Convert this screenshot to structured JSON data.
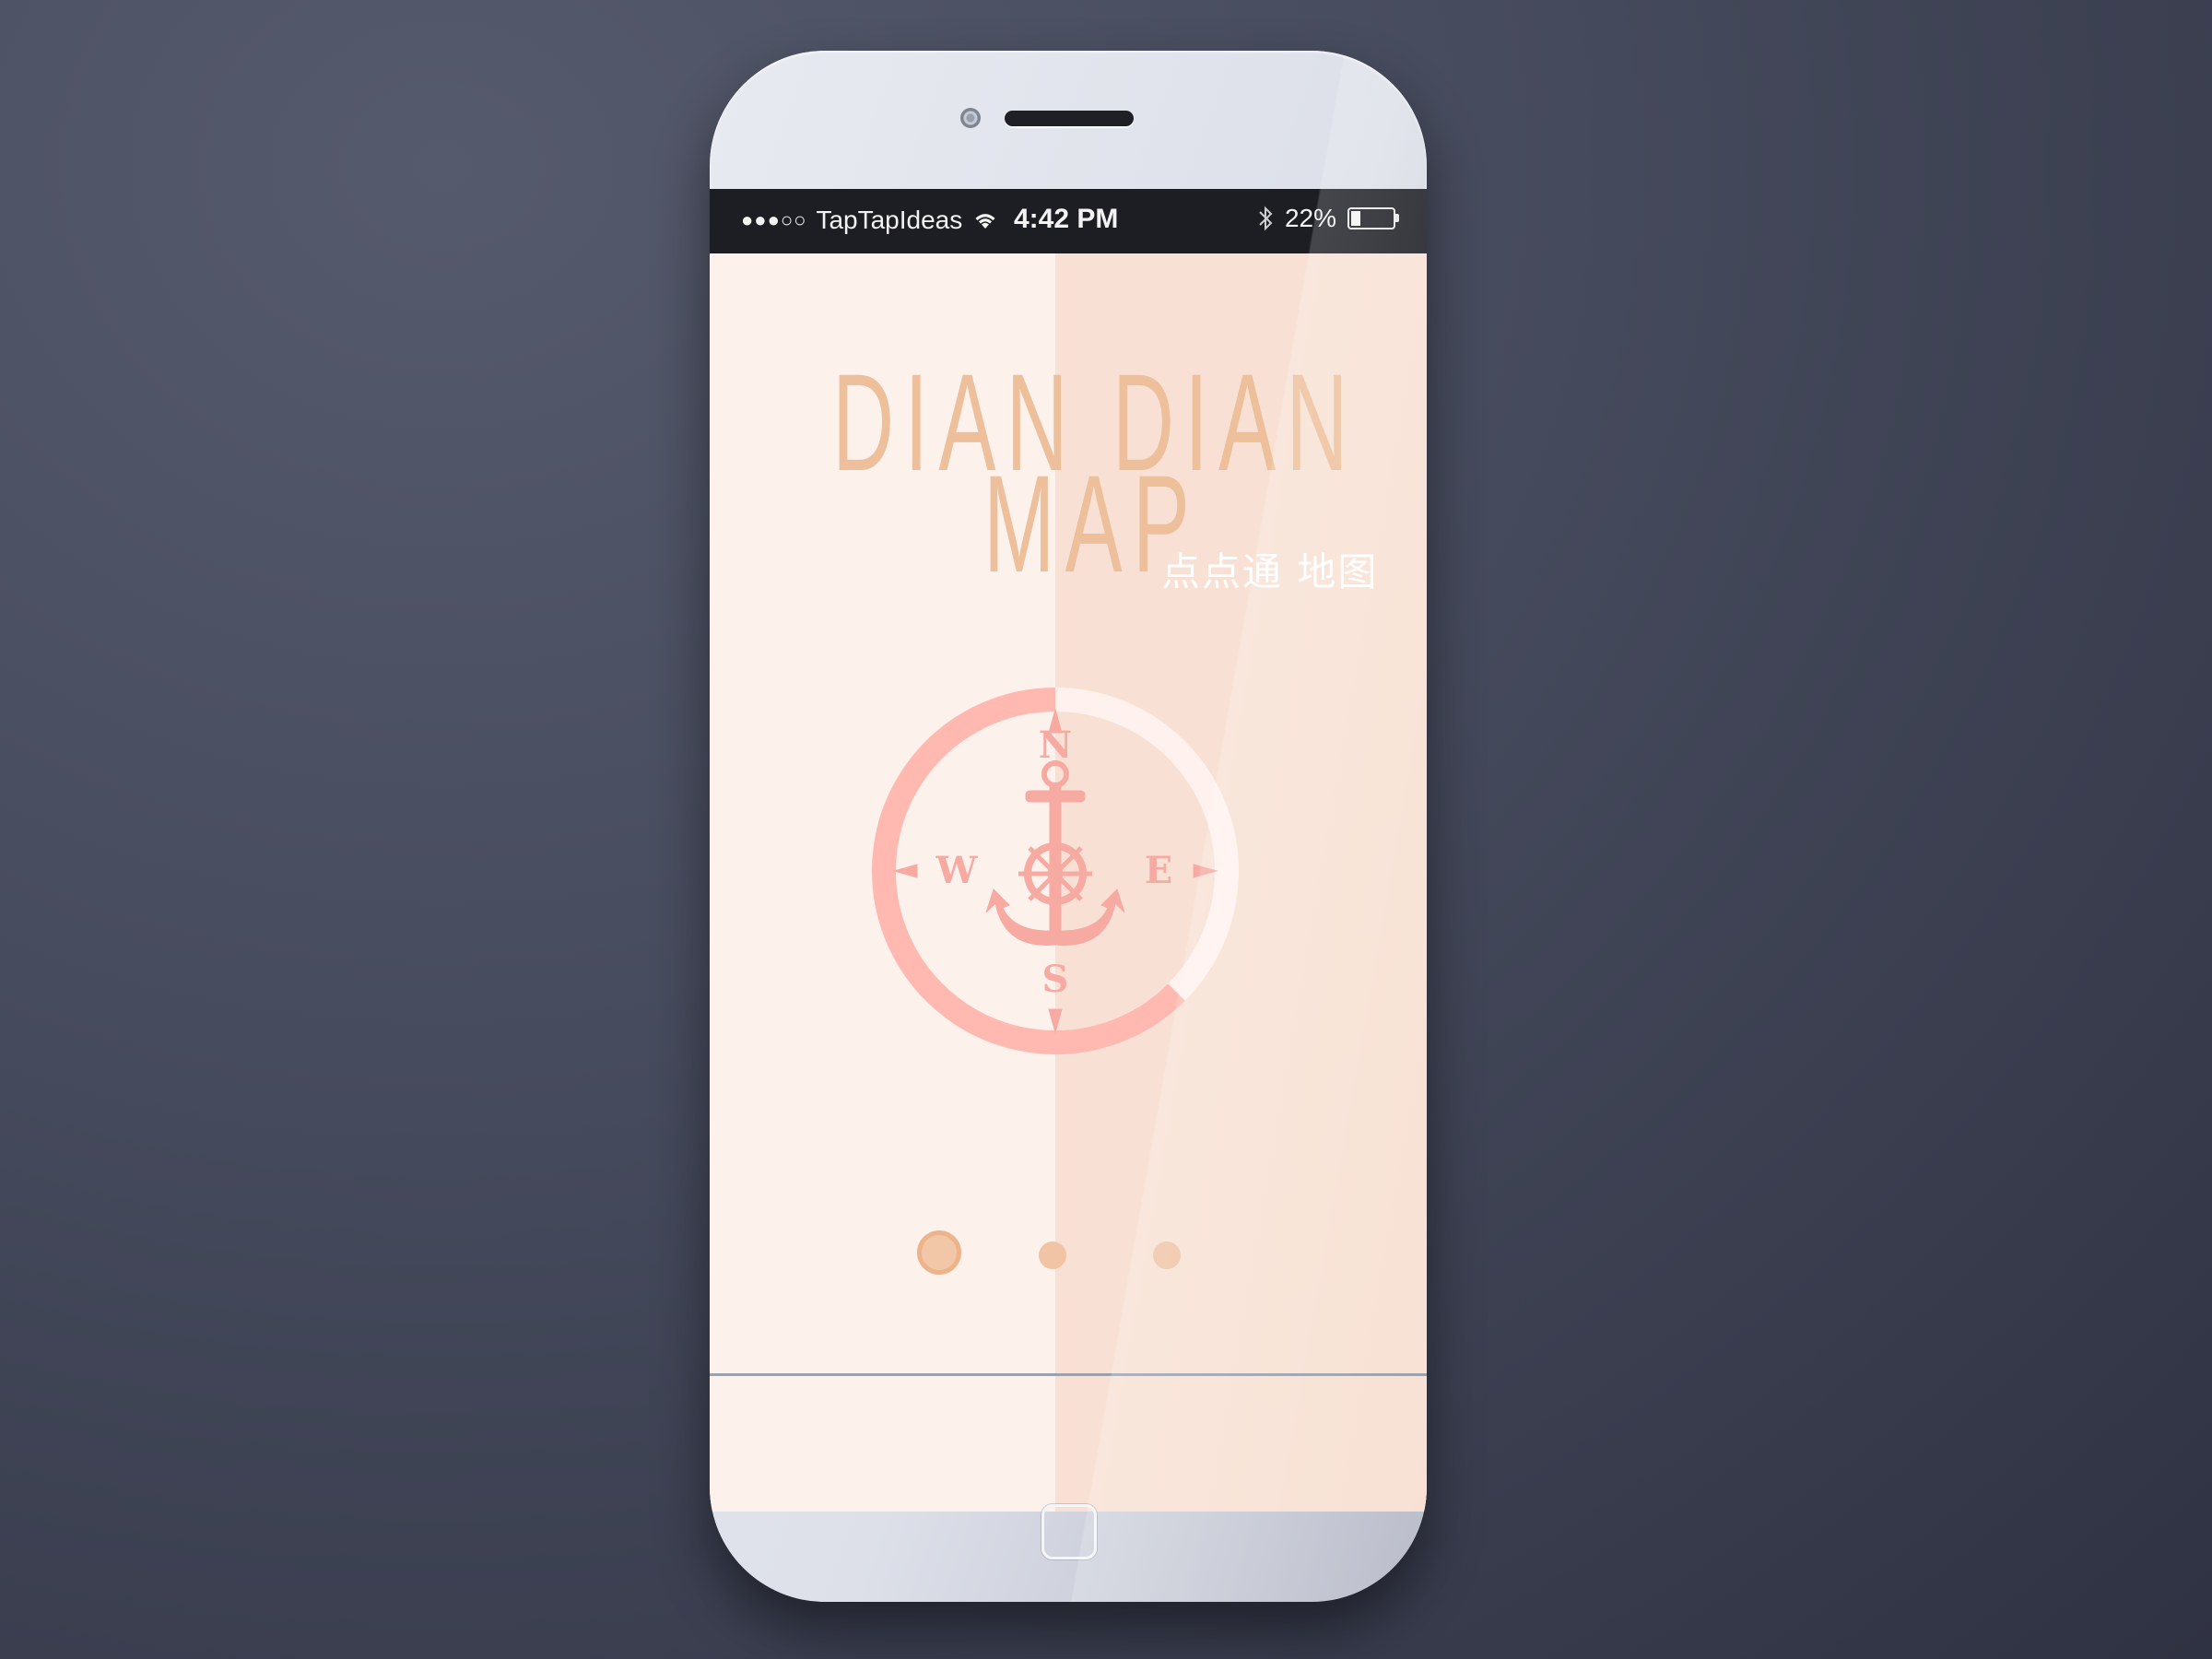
{
  "status_bar": {
    "signal": "●●●○○",
    "carrier": "TapTapIdeas",
    "time": "4:42 PM",
    "battery_percent": "22%",
    "battery_level": 0.22
  },
  "splash": {
    "title_line1": "DIAN DIAN",
    "title_line2": "MAP",
    "chinese_title": "点点通 地图",
    "compass": {
      "north": "N",
      "south": "S",
      "east": "E",
      "west": "W",
      "progress": 0.375
    }
  },
  "pager": {
    "page_count": 3,
    "active_index": 0
  },
  "colors": {
    "background_left": "#fdf1ec",
    "background_right": "#f8e1d4",
    "title": "#edbf9b",
    "compass_ring": "#ffb9b1",
    "compass_track": "#fff2ee",
    "compass_icon": "#f7aaa2",
    "dot": "#f0c4a5"
  },
  "icons": {
    "wifi": "wifi-icon",
    "bluetooth": "bluetooth-icon",
    "battery": "battery-icon",
    "compass": "compass-anchor-icon",
    "home": "home-button-icon"
  }
}
